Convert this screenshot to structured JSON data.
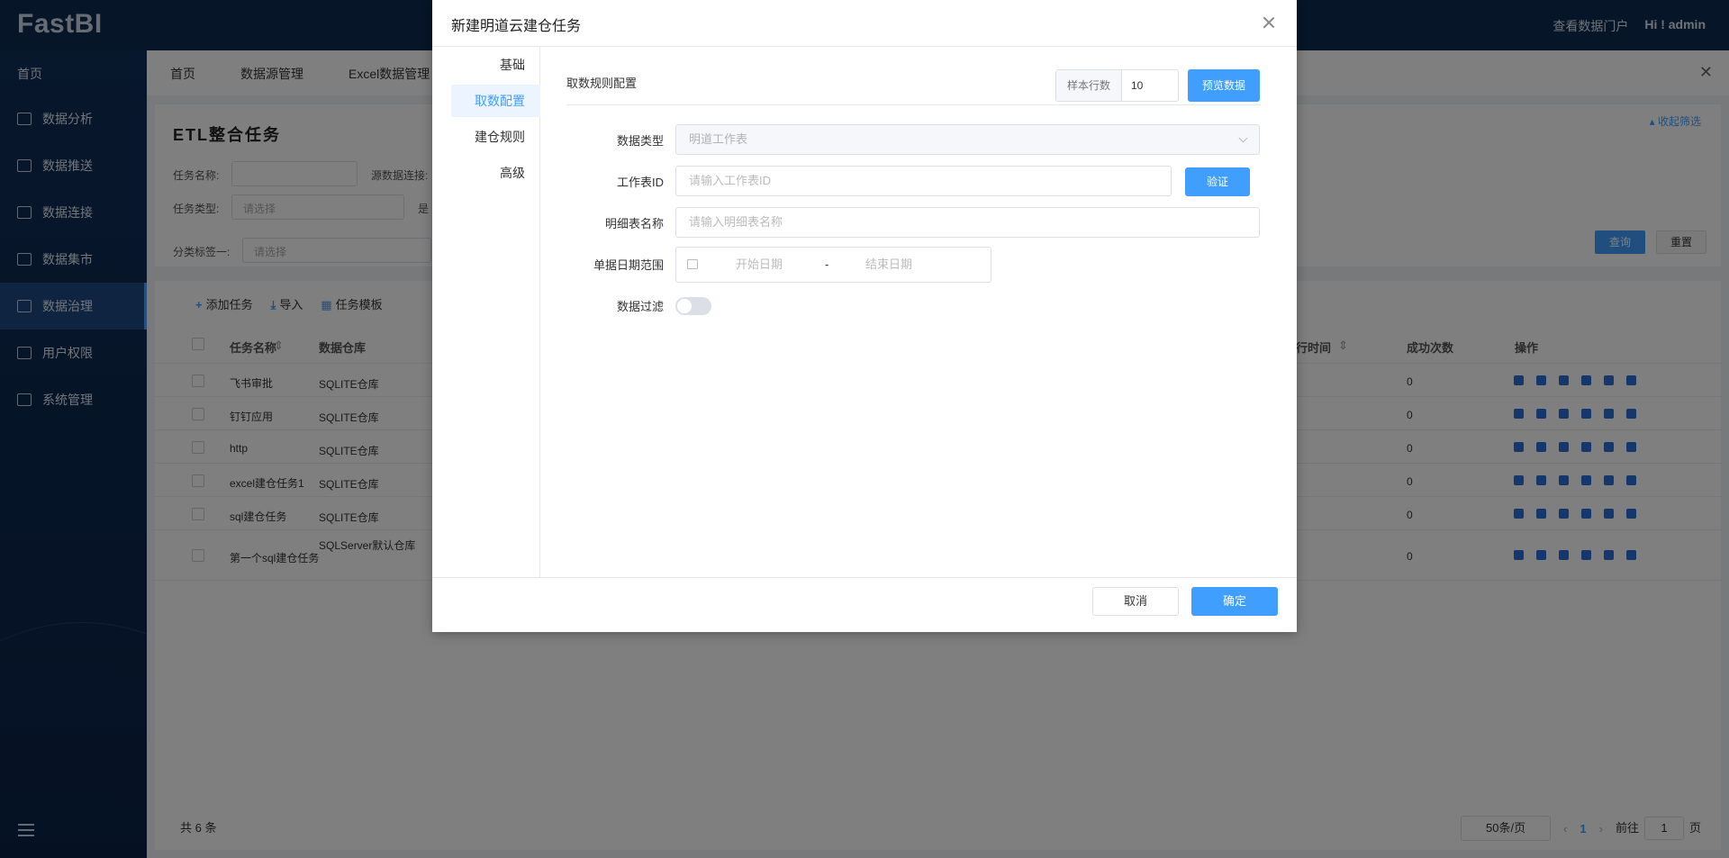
{
  "app": {
    "logo": "FastBI",
    "portal_link": "查看数据门户",
    "greeting": "Hi ! admin"
  },
  "sidebar": {
    "home": "首页",
    "items": [
      {
        "label": "数据分析",
        "icon": "chart-icon"
      },
      {
        "label": "数据推送",
        "icon": "push-icon"
      },
      {
        "label": "数据连接",
        "icon": "connection-icon"
      },
      {
        "label": "数据集市",
        "icon": "mart-icon"
      },
      {
        "label": "数据治理",
        "icon": "governance-icon",
        "active": true
      },
      {
        "label": "用户权限",
        "icon": "user-permission-icon"
      },
      {
        "label": "系统管理",
        "icon": "system-icon"
      }
    ]
  },
  "tabs": [
    "首页",
    "数据源管理",
    "Excel数据管理"
  ],
  "page": {
    "title": "ETL整合任务",
    "collapse": "收起筛选",
    "filters": {
      "task_name_label": "任务名称:",
      "source_label": "源数据连接:",
      "task_type_label": "任务类型:",
      "task_type_placeholder": "请选择",
      "is_label": "是",
      "tag_label": "分类标签一:",
      "tag_placeholder": "请选择"
    },
    "query": "查询",
    "reset": "重置"
  },
  "toolbar": {
    "add": "添加任务",
    "import": "导入",
    "template": "任务模板"
  },
  "table": {
    "headers": {
      "name": "任务名称",
      "warehouse": "数据仓库",
      "exec_time": "行时间",
      "success": "成功次数",
      "ops": "操作"
    },
    "rows": [
      {
        "name": "飞书审批",
        "warehouse": "SQLITE仓库",
        "success": "0"
      },
      {
        "name": "钉钉应用",
        "warehouse": "SQLITE仓库",
        "success": "0"
      },
      {
        "name": "http",
        "warehouse": "SQLITE仓库",
        "success": "0"
      },
      {
        "name": "excel建仓任务1",
        "warehouse": "SQLITE仓库",
        "success": "0"
      },
      {
        "name": "sql建仓任务",
        "warehouse": "SQLITE仓库",
        "success": "0"
      },
      {
        "name": "第一个sql建仓任务",
        "warehouse": "SQLServer默认仓库",
        "success": "0"
      }
    ]
  },
  "pager": {
    "total": "共 6 条",
    "size": "50条/页",
    "current": "1",
    "goto_prefix": "前往",
    "goto_value": "1",
    "goto_suffix": "页"
  },
  "dialog": {
    "title": "新建明道云建仓任务",
    "nav": [
      "基础",
      "取数配置",
      "建仓规则",
      "高级"
    ],
    "active_nav": "取数配置",
    "section_title": "取数规则配置",
    "sample_label": "样本行数",
    "sample_value": "10",
    "preview": "预览数据",
    "data_type_label": "数据类型",
    "data_type_value": "明道工作表",
    "sheet_id_label": "工作表ID",
    "sheet_id_placeholder": "请输入工作表ID",
    "verify": "验证",
    "detail_name_label": "明细表名称",
    "detail_name_placeholder": "请输入明细表名称",
    "date_range_label": "单据日期范围",
    "start_date": "开始日期",
    "date_sep": "-",
    "end_date": "结束日期",
    "filter_label": "数据过滤",
    "filter_on": false,
    "cancel": "取消",
    "ok": "确定"
  }
}
